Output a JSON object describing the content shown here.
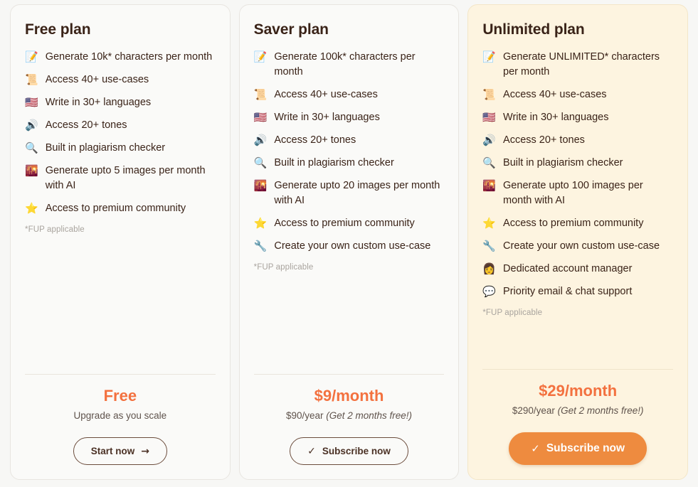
{
  "accent_color": "#f3713f",
  "cta_fill_color": "#ee8b3f",
  "highlight_card_bg": "#fdf4e0",
  "plans": [
    {
      "title": "Free plan",
      "highlighted": false,
      "features": [
        {
          "icon": "📝",
          "icon_name": "memo-icon",
          "text": "Generate 10k* characters per month"
        },
        {
          "icon": "📜",
          "icon_name": "scroll-icon",
          "text": "Access 40+ use-cases"
        },
        {
          "icon": "🇺🇸",
          "icon_name": "flag-icon",
          "text": "Write in 30+ languages"
        },
        {
          "icon": "🔊",
          "icon_name": "speaker-icon",
          "text": "Access 20+ tones"
        },
        {
          "icon": "🔍",
          "icon_name": "magnifying-glass-icon",
          "text": "Built in plagiarism checker"
        },
        {
          "icon": "🌇",
          "icon_name": "cityscape-icon",
          "text": "Generate upto 5 images per month with AI"
        },
        {
          "icon": "⭐",
          "icon_name": "star-icon",
          "text": "Access to premium community"
        }
      ],
      "fup_note": "*FUP applicable",
      "price_main": "Free",
      "price_sub_plain": "Upgrade as you scale",
      "price_sub_promo": "",
      "cta_label": "Start now",
      "cta_glyph": "→",
      "cta_glyph_name": "arrow-right-icon",
      "cta_glyph_position": "after",
      "cta_filled": false
    },
    {
      "title": "Saver plan",
      "highlighted": false,
      "features": [
        {
          "icon": "📝",
          "icon_name": "memo-icon",
          "text": "Generate 100k* characters per month"
        },
        {
          "icon": "📜",
          "icon_name": "scroll-icon",
          "text": "Access 40+ use-cases"
        },
        {
          "icon": "🇺🇸",
          "icon_name": "flag-icon",
          "text": "Write in 30+ languages"
        },
        {
          "icon": "🔊",
          "icon_name": "speaker-icon",
          "text": "Access 20+ tones"
        },
        {
          "icon": "🔍",
          "icon_name": "magnifying-glass-icon",
          "text": "Built in plagiarism checker"
        },
        {
          "icon": "🌇",
          "icon_name": "cityscape-icon",
          "text": "Generate upto 20 images per month with AI"
        },
        {
          "icon": "⭐",
          "icon_name": "star-icon",
          "text": "Access to premium community"
        },
        {
          "icon": "🔧",
          "icon_name": "wrench-icon",
          "text": "Create your own custom use-case"
        }
      ],
      "fup_note": "*FUP applicable",
      "price_main": "$9/month",
      "price_sub_plain": "$90/year ",
      "price_sub_promo": "(Get 2 months free!)",
      "cta_label": "Subscribe now",
      "cta_glyph": "✓",
      "cta_glyph_name": "check-icon",
      "cta_glyph_position": "before",
      "cta_filled": false
    },
    {
      "title": "Unlimited plan",
      "highlighted": true,
      "features": [
        {
          "icon": "📝",
          "icon_name": "memo-icon",
          "text": "Generate UNLIMITED* characters per month"
        },
        {
          "icon": "📜",
          "icon_name": "scroll-icon",
          "text": "Access 40+ use-cases"
        },
        {
          "icon": "🇺🇸",
          "icon_name": "flag-icon",
          "text": "Write in 30+ languages"
        },
        {
          "icon": "🔊",
          "icon_name": "speaker-icon",
          "text": "Access 20+ tones"
        },
        {
          "icon": "🔍",
          "icon_name": "magnifying-glass-icon",
          "text": "Built in plagiarism checker"
        },
        {
          "icon": "🌇",
          "icon_name": "cityscape-icon",
          "text": "Generate upto 100 images per month with AI"
        },
        {
          "icon": "⭐",
          "icon_name": "star-icon",
          "text": "Access to premium community"
        },
        {
          "icon": "🔧",
          "icon_name": "wrench-icon",
          "text": "Create your own custom use-case"
        },
        {
          "icon": "👩",
          "icon_name": "account-manager-icon",
          "text": "Dedicated account manager"
        },
        {
          "icon": "💬",
          "icon_name": "speech-balloon-icon",
          "text": "Priority email & chat support"
        }
      ],
      "fup_note": "*FUP applicable",
      "price_main": "$29/month",
      "price_sub_plain": "$290/year ",
      "price_sub_promo": "(Get 2 months free!)",
      "cta_label": "Subscribe now",
      "cta_glyph": "✓",
      "cta_glyph_name": "check-icon",
      "cta_glyph_position": "before",
      "cta_filled": true
    }
  ]
}
